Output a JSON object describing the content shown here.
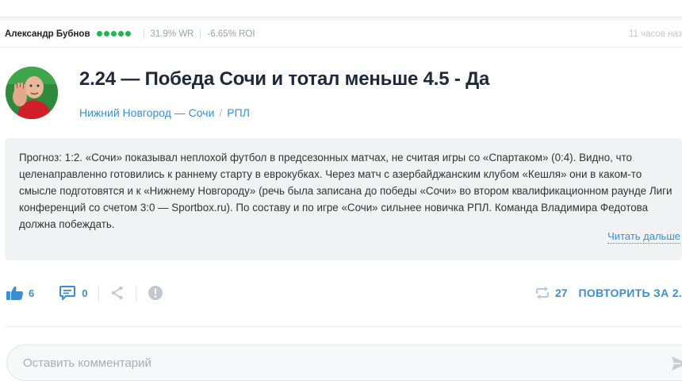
{
  "meta": {
    "author": "Александр Бубнов",
    "rating_dots": [
      "#1fb650",
      "#1fb650",
      "#1fb650",
      "#1fb650",
      "#1fb650"
    ],
    "win_rate": "31.9% WR",
    "roi": "-6.65% ROI",
    "time": "11 часов наз"
  },
  "post": {
    "headline": "2.24 — Победа Сочи и тотал меньше 4.5 - Да",
    "match": "Нижний Новгород — Сочи",
    "separator": "/",
    "league": "РПЛ",
    "forecast": "Прогноз: 1:2. «Сочи» показывал неплохой футбол в предсезонных матчах, не считая игры со «Спартаком» (0:4). Видно, что целенаправленно готовились к раннему старту в еврокубках. Через матч с азербайджанским клубом «Кешля» они в каком-то смысле подготовятся и к «Нижнему Новгороду» (речь была записана до победы «Сочи» во втором квалификационном раунде Лиги конференций со счетом 3:0 — Sportbox.ru). По составу и по игре «Сочи» сильнее новичка РПЛ. Команда Владимира Федотова должна побеждать.",
    "read_more": "Читать дальше"
  },
  "actions": {
    "likes": "6",
    "comments": "0",
    "repeats": "27",
    "repeat_label": "ПОВТОРИТЬ ЗА 2.",
    "icons": [
      "thumbs-up-icon",
      "comment-icon",
      "share-icon",
      "report-icon",
      "repeat-icon"
    ]
  },
  "comment_box": {
    "placeholder": "Оставить комментарий"
  },
  "colors": {
    "accent": "#3a8fd4",
    "rating": "#1fb650",
    "headline": "#1e2a3a"
  }
}
